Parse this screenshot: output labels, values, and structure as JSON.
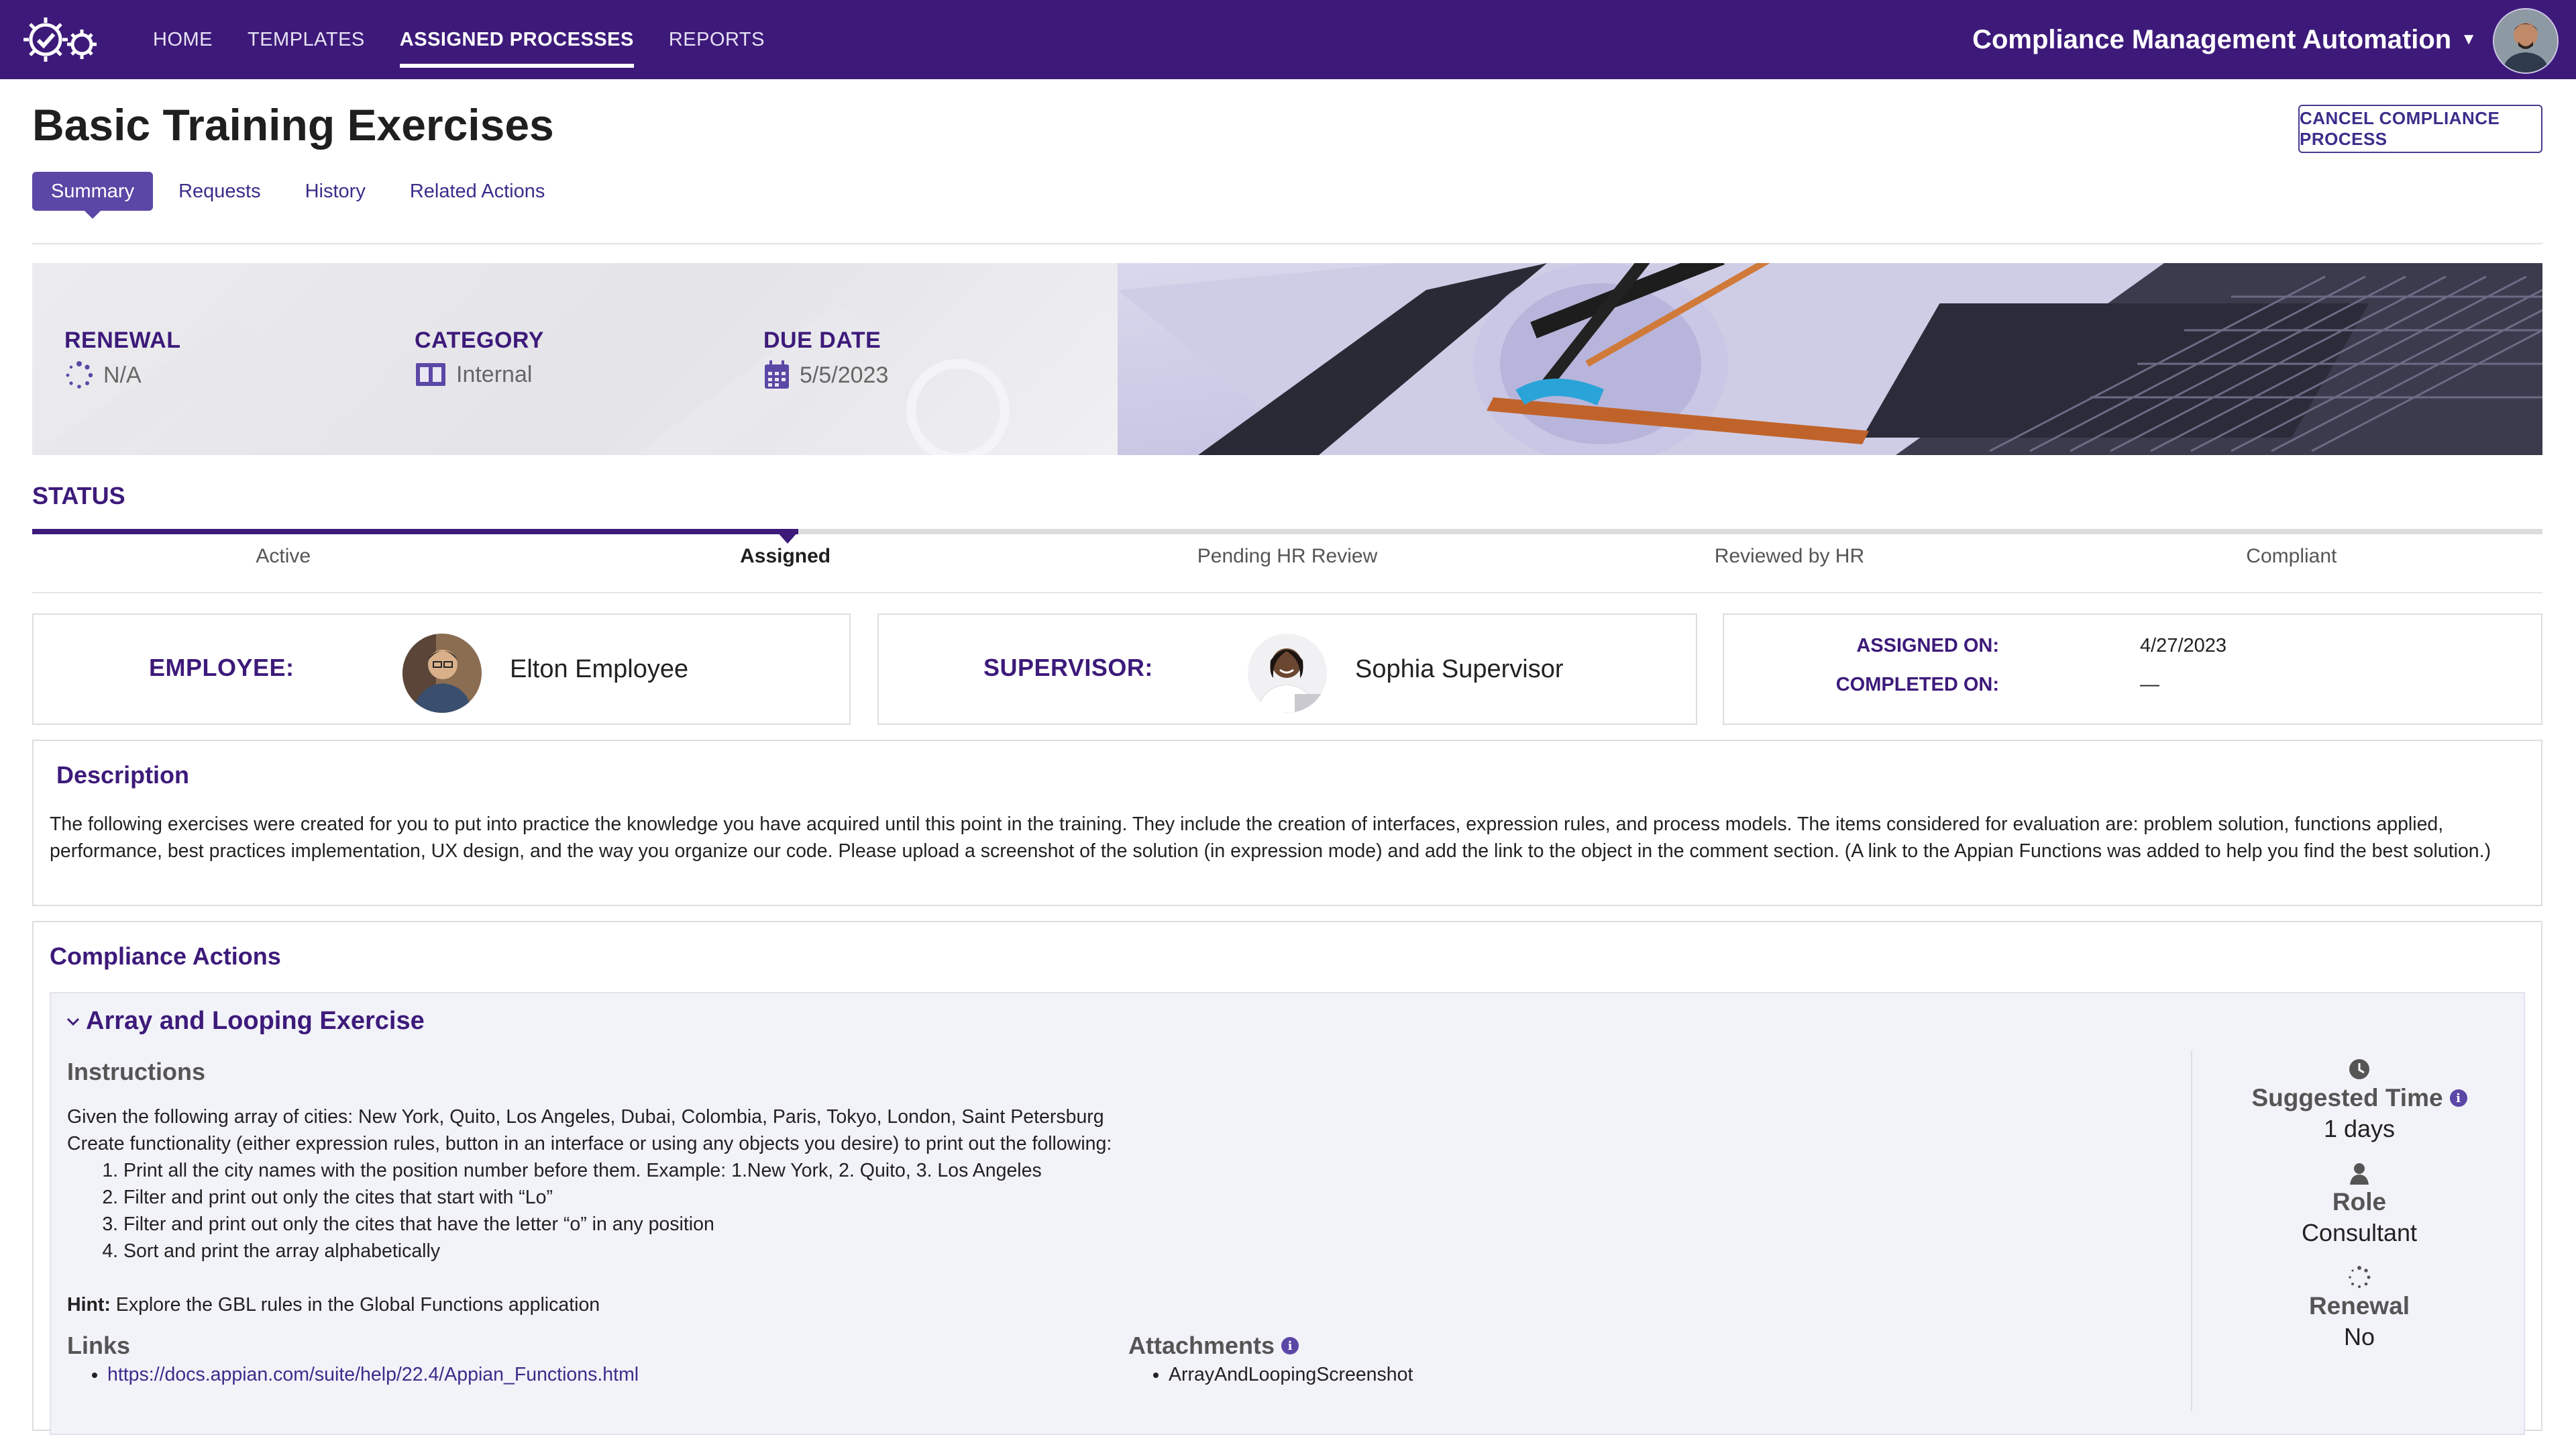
{
  "nav": {
    "items": [
      {
        "label": "HOME"
      },
      {
        "label": "TEMPLATES"
      },
      {
        "label": "ASSIGNED PROCESSES",
        "active": true
      },
      {
        "label": "REPORTS"
      }
    ],
    "app_title": "Compliance Management Automation",
    "logo_icon": "gear-check-icon",
    "caret_icon": "caret-down-icon",
    "avatar_icon": "user-avatar"
  },
  "header": {
    "title": "Basic Training Exercises",
    "cancel_label": "CANCEL COMPLIANCE PROCESS",
    "tabs": [
      {
        "label": "Summary",
        "active": true
      },
      {
        "label": "Requests"
      },
      {
        "label": "History"
      },
      {
        "label": "Related Actions"
      }
    ]
  },
  "summary": {
    "renewal": {
      "label": "RENEWAL",
      "value": "N/A",
      "icon": "spinner-icon"
    },
    "category": {
      "label": "CATEGORY",
      "value": "Internal",
      "icon": "book-icon"
    },
    "due_date": {
      "label": "DUE DATE",
      "value": "5/5/2023",
      "icon": "calendar-icon"
    }
  },
  "status": {
    "label": "STATUS",
    "stages": [
      "Active",
      "Assigned",
      "Pending HR Review",
      "Reviewed by HR",
      "Compliant"
    ],
    "current": "Assigned"
  },
  "people": {
    "employee": {
      "label": "EMPLOYEE:",
      "name": "Elton Employee"
    },
    "supervisor": {
      "label": "SUPERVISOR:",
      "name": "Sophia Supervisor"
    },
    "dates": {
      "assigned_label": "ASSIGNED ON:",
      "assigned_value": "4/27/2023",
      "completed_label": "COMPLETED ON:",
      "completed_value": "—"
    }
  },
  "description": {
    "title": "Description",
    "text": "The following exercises were created for you to put into practice the knowledge you have acquired until this point in the training. They include the creation of interfaces, expression rules, and process models. The items considered for evaluation are: problem solution, functions applied, performance, best practices implementation, UX design, and the way you organize our code. Please upload a screenshot of the solution (in expression mode) and add the link to the object in the comment section. (A link to the Appian Functions was added to help you find the best solution.)"
  },
  "compliance": {
    "title": "Compliance Actions",
    "exercise": {
      "title": "Array and Looping Exercise",
      "instructions_title": "Instructions",
      "intro1": "Given the following array of cities: New York, Quito, Los Angeles, Dubai, Colombia, Paris, Tokyo, London, Saint Petersburg",
      "intro2": "Create functionality (either expression rules, button in an interface or using any objects you desire) to print out the following:",
      "steps": [
        "Print all the city names with the position number before them. Example: 1.New York, 2. Quito, 3. Los Angeles",
        "Filter and print out only the cites that start with “Lo”",
        "Filter and print out only the cites that have the letter “o” in any position",
        "Sort and print the array alphabetically"
      ],
      "hint_label": "Hint:",
      "hint_text": " Explore the GBL rules in the Global Functions application",
      "links_title": "Links",
      "links": [
        "https://docs.appian.com/suite/help/22.4/Appian_Functions.html"
      ],
      "attachments_title": "Attachments",
      "attachments": [
        "ArrayAndLoopingScreenshot"
      ],
      "suggested_time_label": "Suggested Time",
      "suggested_time_value": "1 days",
      "role_label": "Role",
      "role_value": "Consultant",
      "renewal_label": "Renewal",
      "renewal_value": "No"
    }
  },
  "colors": {
    "brand": "#3d1a7a",
    "accent": "#5b47a6",
    "panel": "#f2f2f9"
  }
}
